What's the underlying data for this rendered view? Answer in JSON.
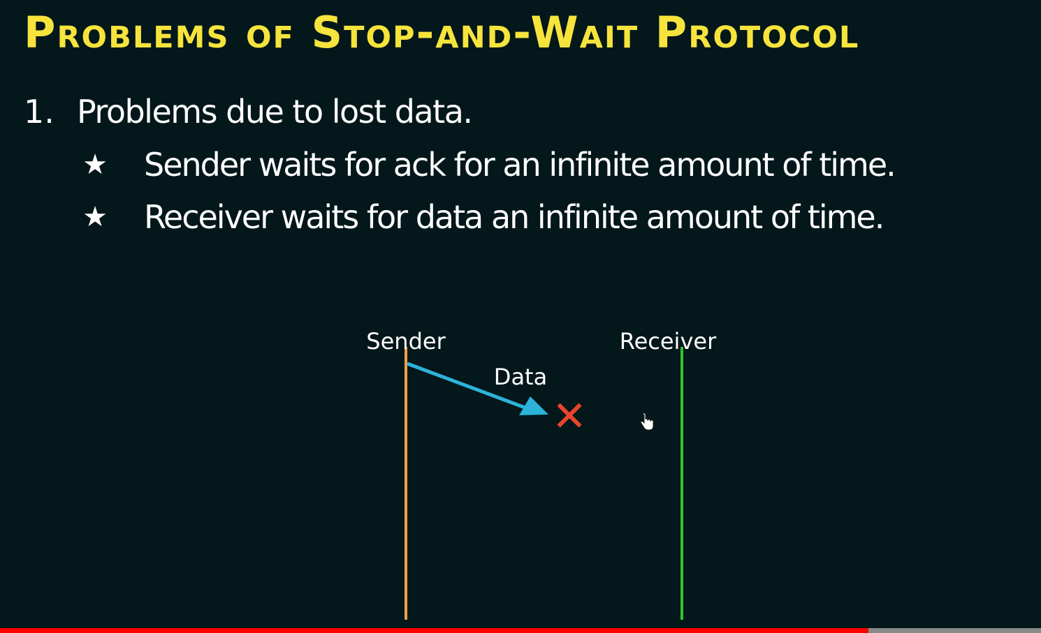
{
  "slide": {
    "title": "Problems of Stop-and-Wait Protocol",
    "point": {
      "number": "1.",
      "text": "Problems due to lost data."
    },
    "sub_points": [
      {
        "bullet": "★",
        "text": "Sender waits for ack for an infinite amount of time."
      },
      {
        "bullet": "★",
        "text": "Receiver waits for data an infinite amount of time."
      }
    ]
  },
  "diagram": {
    "sender_label": "Sender",
    "receiver_label": "Receiver",
    "data_label": "Data",
    "lost_mark": "✕",
    "colors": {
      "sender_line": "#f0a04b",
      "receiver_line": "#2ec52e",
      "data_arrow": "#2cb3da",
      "lost_mark": "#e8442c"
    }
  },
  "icons": {
    "cursor": "hand-pointer-icon"
  },
  "video": {
    "progress_fraction": 0.834
  },
  "colors": {
    "background": "#04171a",
    "title": "#f6e43c",
    "text": "#ffffff",
    "progress": "#ff0000"
  }
}
